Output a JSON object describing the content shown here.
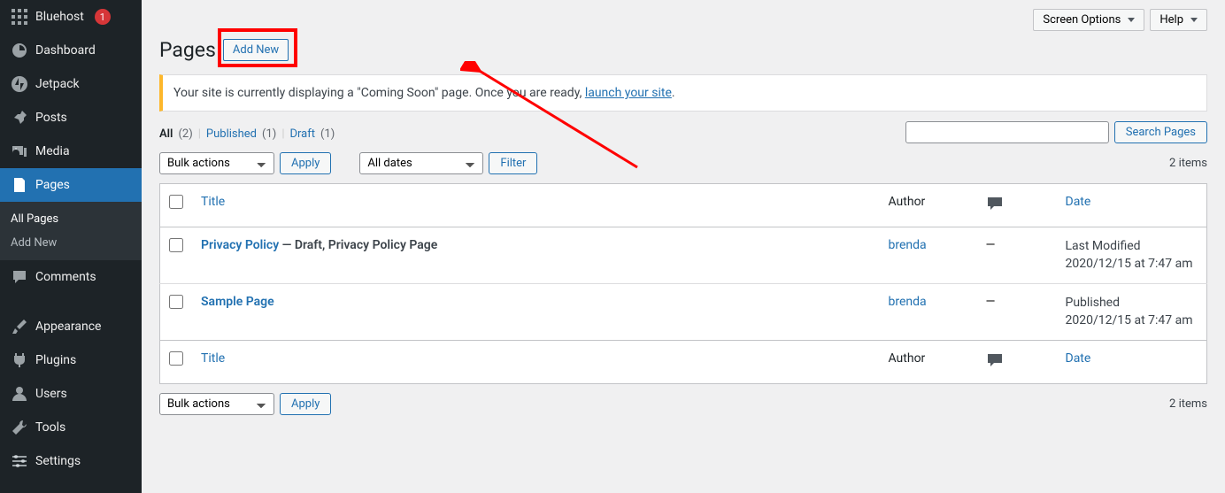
{
  "sidebar": {
    "items": [
      {
        "label": "Bluehost",
        "icon": "grid-icon",
        "badge": "1"
      },
      {
        "label": "Dashboard",
        "icon": "dashboard-icon"
      },
      {
        "label": "Jetpack",
        "icon": "jetpack-icon"
      },
      {
        "label": "Posts",
        "icon": "pin-icon"
      },
      {
        "label": "Media",
        "icon": "media-icon"
      },
      {
        "label": "Pages",
        "icon": "pages-icon",
        "active": true
      },
      {
        "label": "Comments",
        "icon": "comments-icon"
      },
      {
        "label": "Appearance",
        "icon": "brush-icon"
      },
      {
        "label": "Plugins",
        "icon": "plugin-icon"
      },
      {
        "label": "Users",
        "icon": "users-icon"
      },
      {
        "label": "Tools",
        "icon": "tools-icon"
      },
      {
        "label": "Settings",
        "icon": "settings-icon"
      }
    ],
    "sub": [
      {
        "label": "All Pages"
      },
      {
        "label": "Add New"
      }
    ]
  },
  "topbar": {
    "screen_options": "Screen Options",
    "help": "Help"
  },
  "page": {
    "title": "Pages",
    "add_new": "Add New"
  },
  "notice": {
    "text_before": "Your site is currently displaying a \"Coming Soon\" page. Once you are ready, ",
    "link": "launch your site",
    "text_after": "."
  },
  "filters": {
    "all": "All",
    "all_count": "(2)",
    "published": "Published",
    "published_count": "(1)",
    "draft": "Draft",
    "draft_count": "(1)"
  },
  "search": {
    "button": "Search Pages"
  },
  "tablenav": {
    "bulk": "Bulk actions",
    "apply": "Apply",
    "dates": "All dates",
    "filter": "Filter"
  },
  "items_count": "2 items",
  "columns": {
    "title": "Title",
    "author": "Author",
    "date": "Date"
  },
  "rows": [
    {
      "title": "Privacy Policy",
      "state": " — Draft, Privacy Policy Page",
      "author": "brenda",
      "comments": "—",
      "date_label": "Last Modified",
      "date_value": "2020/12/15 at 7:47 am"
    },
    {
      "title": "Sample Page",
      "state": "",
      "author": "brenda",
      "comments": "—",
      "date_label": "Published",
      "date_value": "2020/12/15 at 7:47 am"
    }
  ]
}
